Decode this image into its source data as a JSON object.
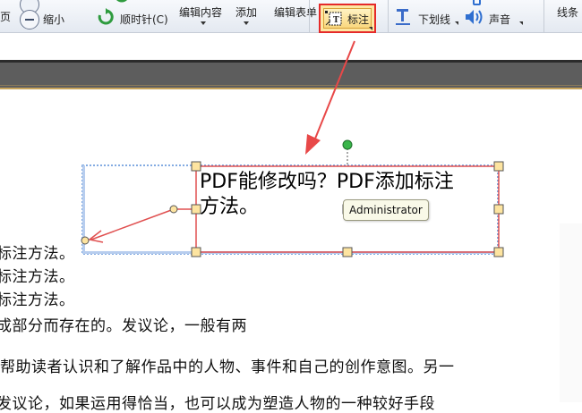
{
  "ribbon": {
    "prev_page_label": "页",
    "zoom_out_label": "缩小",
    "rotate_cw_label": "顺时针(C)",
    "edit_content_label": "编辑内容",
    "add_label": "添加",
    "edit_form_label": "编辑表单",
    "callout_label": "标注",
    "underline_label": "下划线",
    "sound_label": "声音",
    "line_label": "线条"
  },
  "annotation": {
    "text_line1": "PDF能修改吗？PDF添加标注",
    "text_line2": "方法。",
    "author_tooltip": "Administrator"
  },
  "document": {
    "lines": [
      "标注方法。",
      "标注方法。",
      "标注方法。",
      "成部分而存在的。发议论，一般有两",
      "帮助读者认识和了解作品中的人物、事件和自己的创作意图。另一",
      "发议论，如果运用得恰当，也可以成为塑造人物的一种较好手段"
    ]
  },
  "colors": {
    "highlight": "#e52a2a",
    "handle_fill": "#fde4a0",
    "rotate_handle": "#39b54a"
  }
}
